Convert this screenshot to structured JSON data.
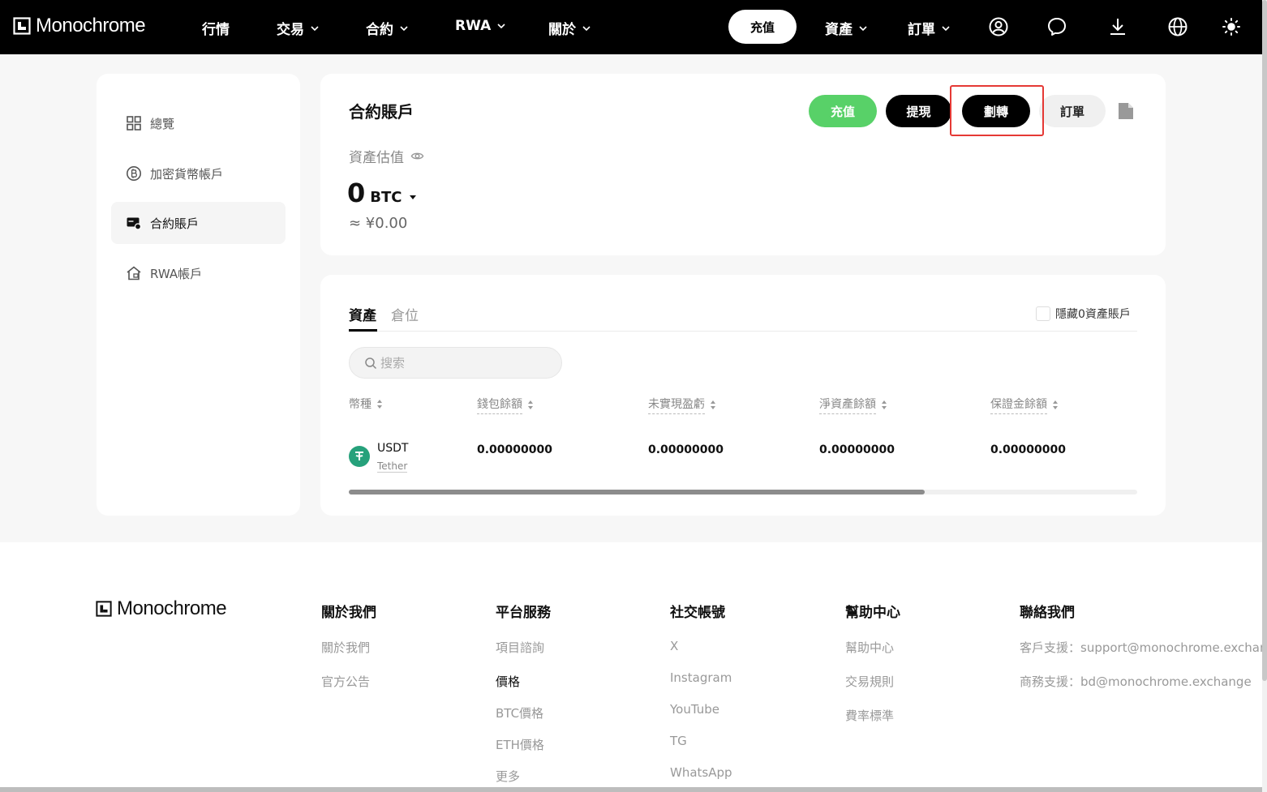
{
  "nav": {
    "brand": "Monochrome",
    "items": [
      {
        "label": "行情",
        "has_menu": false
      },
      {
        "label": "交易",
        "has_menu": true
      },
      {
        "label": "合約",
        "has_menu": true
      },
      {
        "label": "RWA",
        "has_menu": true
      },
      {
        "label": "關於",
        "has_menu": true
      }
    ],
    "deposit": "充值",
    "assets": "資產",
    "orders": "訂單",
    "icons": [
      "user-icon",
      "chat-icon",
      "download-icon",
      "globe-icon",
      "sun-icon"
    ]
  },
  "sidebar": {
    "items": [
      {
        "label": "總覽",
        "icon": "grid-icon"
      },
      {
        "label": "加密貨幣帳戶",
        "icon": "bitcoin-icon"
      },
      {
        "label": "合約賬戶",
        "icon": "wallet-icon",
        "active": true
      },
      {
        "label": "RWA帳戶",
        "icon": "house-icon"
      }
    ]
  },
  "summary": {
    "title": "合約賬戶",
    "est_label": "資產估值",
    "amount": "0",
    "unit": "BTC",
    "fiat": "≈ ¥0.00",
    "buttons": {
      "deposit": "充值",
      "withdraw": "提現",
      "transfer": "劃轉",
      "orders": "訂單"
    }
  },
  "assets": {
    "tabs": [
      "資產",
      "倉位"
    ],
    "hide_zero": "隱藏0資產賬戶",
    "search_placeholder": "搜索",
    "columns": [
      "幣種",
      "錢包餘額",
      "未實現盈虧",
      "淨資產餘額",
      "保證金餘額"
    ],
    "rows": [
      {
        "symbol": "USDT",
        "name": "Tether",
        "wallet": "0.00000000",
        "unrealized": "0.00000000",
        "net": "0.00000000",
        "margin": "0.00000000"
      }
    ],
    "scroll_fraction": 0.73
  },
  "footer": {
    "brand": "Monochrome",
    "about": {
      "head": "關於我們",
      "links": [
        "關於我們",
        "官方公告"
      ]
    },
    "platform": {
      "head": "平台服務",
      "links": [
        "項目諮詢"
      ],
      "sub_head": "價格",
      "sub_links": [
        "BTC價格",
        "ETH價格",
        "更多"
      ]
    },
    "social": {
      "head": "社交帳號",
      "links": [
        "X",
        "Instagram",
        "YouTube",
        "TG",
        "WhatsApp"
      ]
    },
    "help": {
      "head": "幫助中心",
      "links": [
        "幫助中心",
        "交易規則",
        "費率標準"
      ]
    },
    "contact": {
      "head": "聯絡我們",
      "links": [
        "客戶支援：support@monochrome.exchange",
        "商務支援：bd@monochrome.exchange"
      ]
    }
  },
  "colors": {
    "accent_green": "#58d168",
    "highlight_red": "#e53935",
    "tether_green": "#26a17b"
  }
}
